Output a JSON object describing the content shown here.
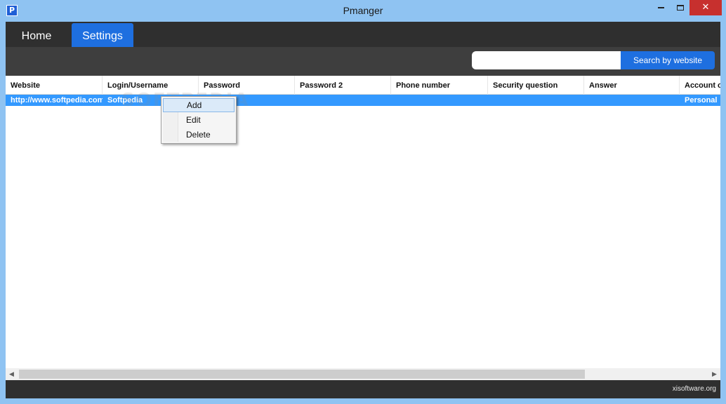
{
  "window": {
    "title": "Pmanger",
    "icon_letter": "P",
    "close_glyph": "✕"
  },
  "tabs": [
    {
      "label": "Home",
      "active": false
    },
    {
      "label": "Settings",
      "active": true
    }
  ],
  "search": {
    "value": "",
    "placeholder": "",
    "button_label": "Search by website"
  },
  "table": {
    "columns": [
      "Website",
      "Login/Username",
      "Password",
      "Password 2",
      "Phone number",
      "Security question",
      "Answer",
      "Account o"
    ],
    "rows": [
      {
        "website": "http://www.softpedia.com",
        "login": "Softpedia",
        "password": "",
        "password2": "",
        "phone": "",
        "question": "",
        "answer": "",
        "account": "Personal"
      }
    ]
  },
  "context_menu": {
    "items": [
      "Add",
      "Edit",
      "Delete"
    ]
  },
  "watermark": "SOFTPEDIA",
  "footer": {
    "text": "xisoftware.org"
  },
  "colors": {
    "accent": "#1e6fe0",
    "selection": "#3399ff",
    "dark_bar": "#2f2f2f",
    "toolbar": "#3e3e3e",
    "close_button": "#c7302e"
  }
}
